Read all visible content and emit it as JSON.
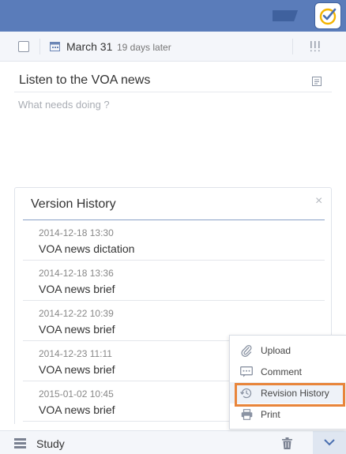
{
  "toolbar": {
    "due_date": "March 31",
    "due_relative": "19 days later"
  },
  "task": {
    "title": "Listen to the VOA news",
    "description_placeholder": "What needs doing ?"
  },
  "version_history": {
    "title": "Version History",
    "close_glyph": "×",
    "items": [
      {
        "timestamp": "2014-12-18 13:30",
        "title": "VOA news dictation"
      },
      {
        "timestamp": "2014-12-18 13:36",
        "title": "VOA news brief"
      },
      {
        "timestamp": "2014-12-22 10:39",
        "title": "VOA news brief"
      },
      {
        "timestamp": "2014-12-23 11:11",
        "title": "VOA news brief"
      },
      {
        "timestamp": "2015-01-02 10:45",
        "title": "VOA news brief"
      }
    ]
  },
  "context_menu": {
    "items": [
      {
        "label": "Upload",
        "icon": "paperclip-icon"
      },
      {
        "label": "Comment",
        "icon": "comment-icon"
      },
      {
        "label": "Revision History",
        "icon": "history-icon",
        "highlighted": true
      },
      {
        "label": "Print",
        "icon": "printer-icon"
      }
    ]
  },
  "bottom": {
    "list_name": "Study"
  },
  "colors": {
    "header_blue": "#5a7cba",
    "highlight_orange": "#e8853b",
    "accent_blue": "#8aa2c8"
  }
}
